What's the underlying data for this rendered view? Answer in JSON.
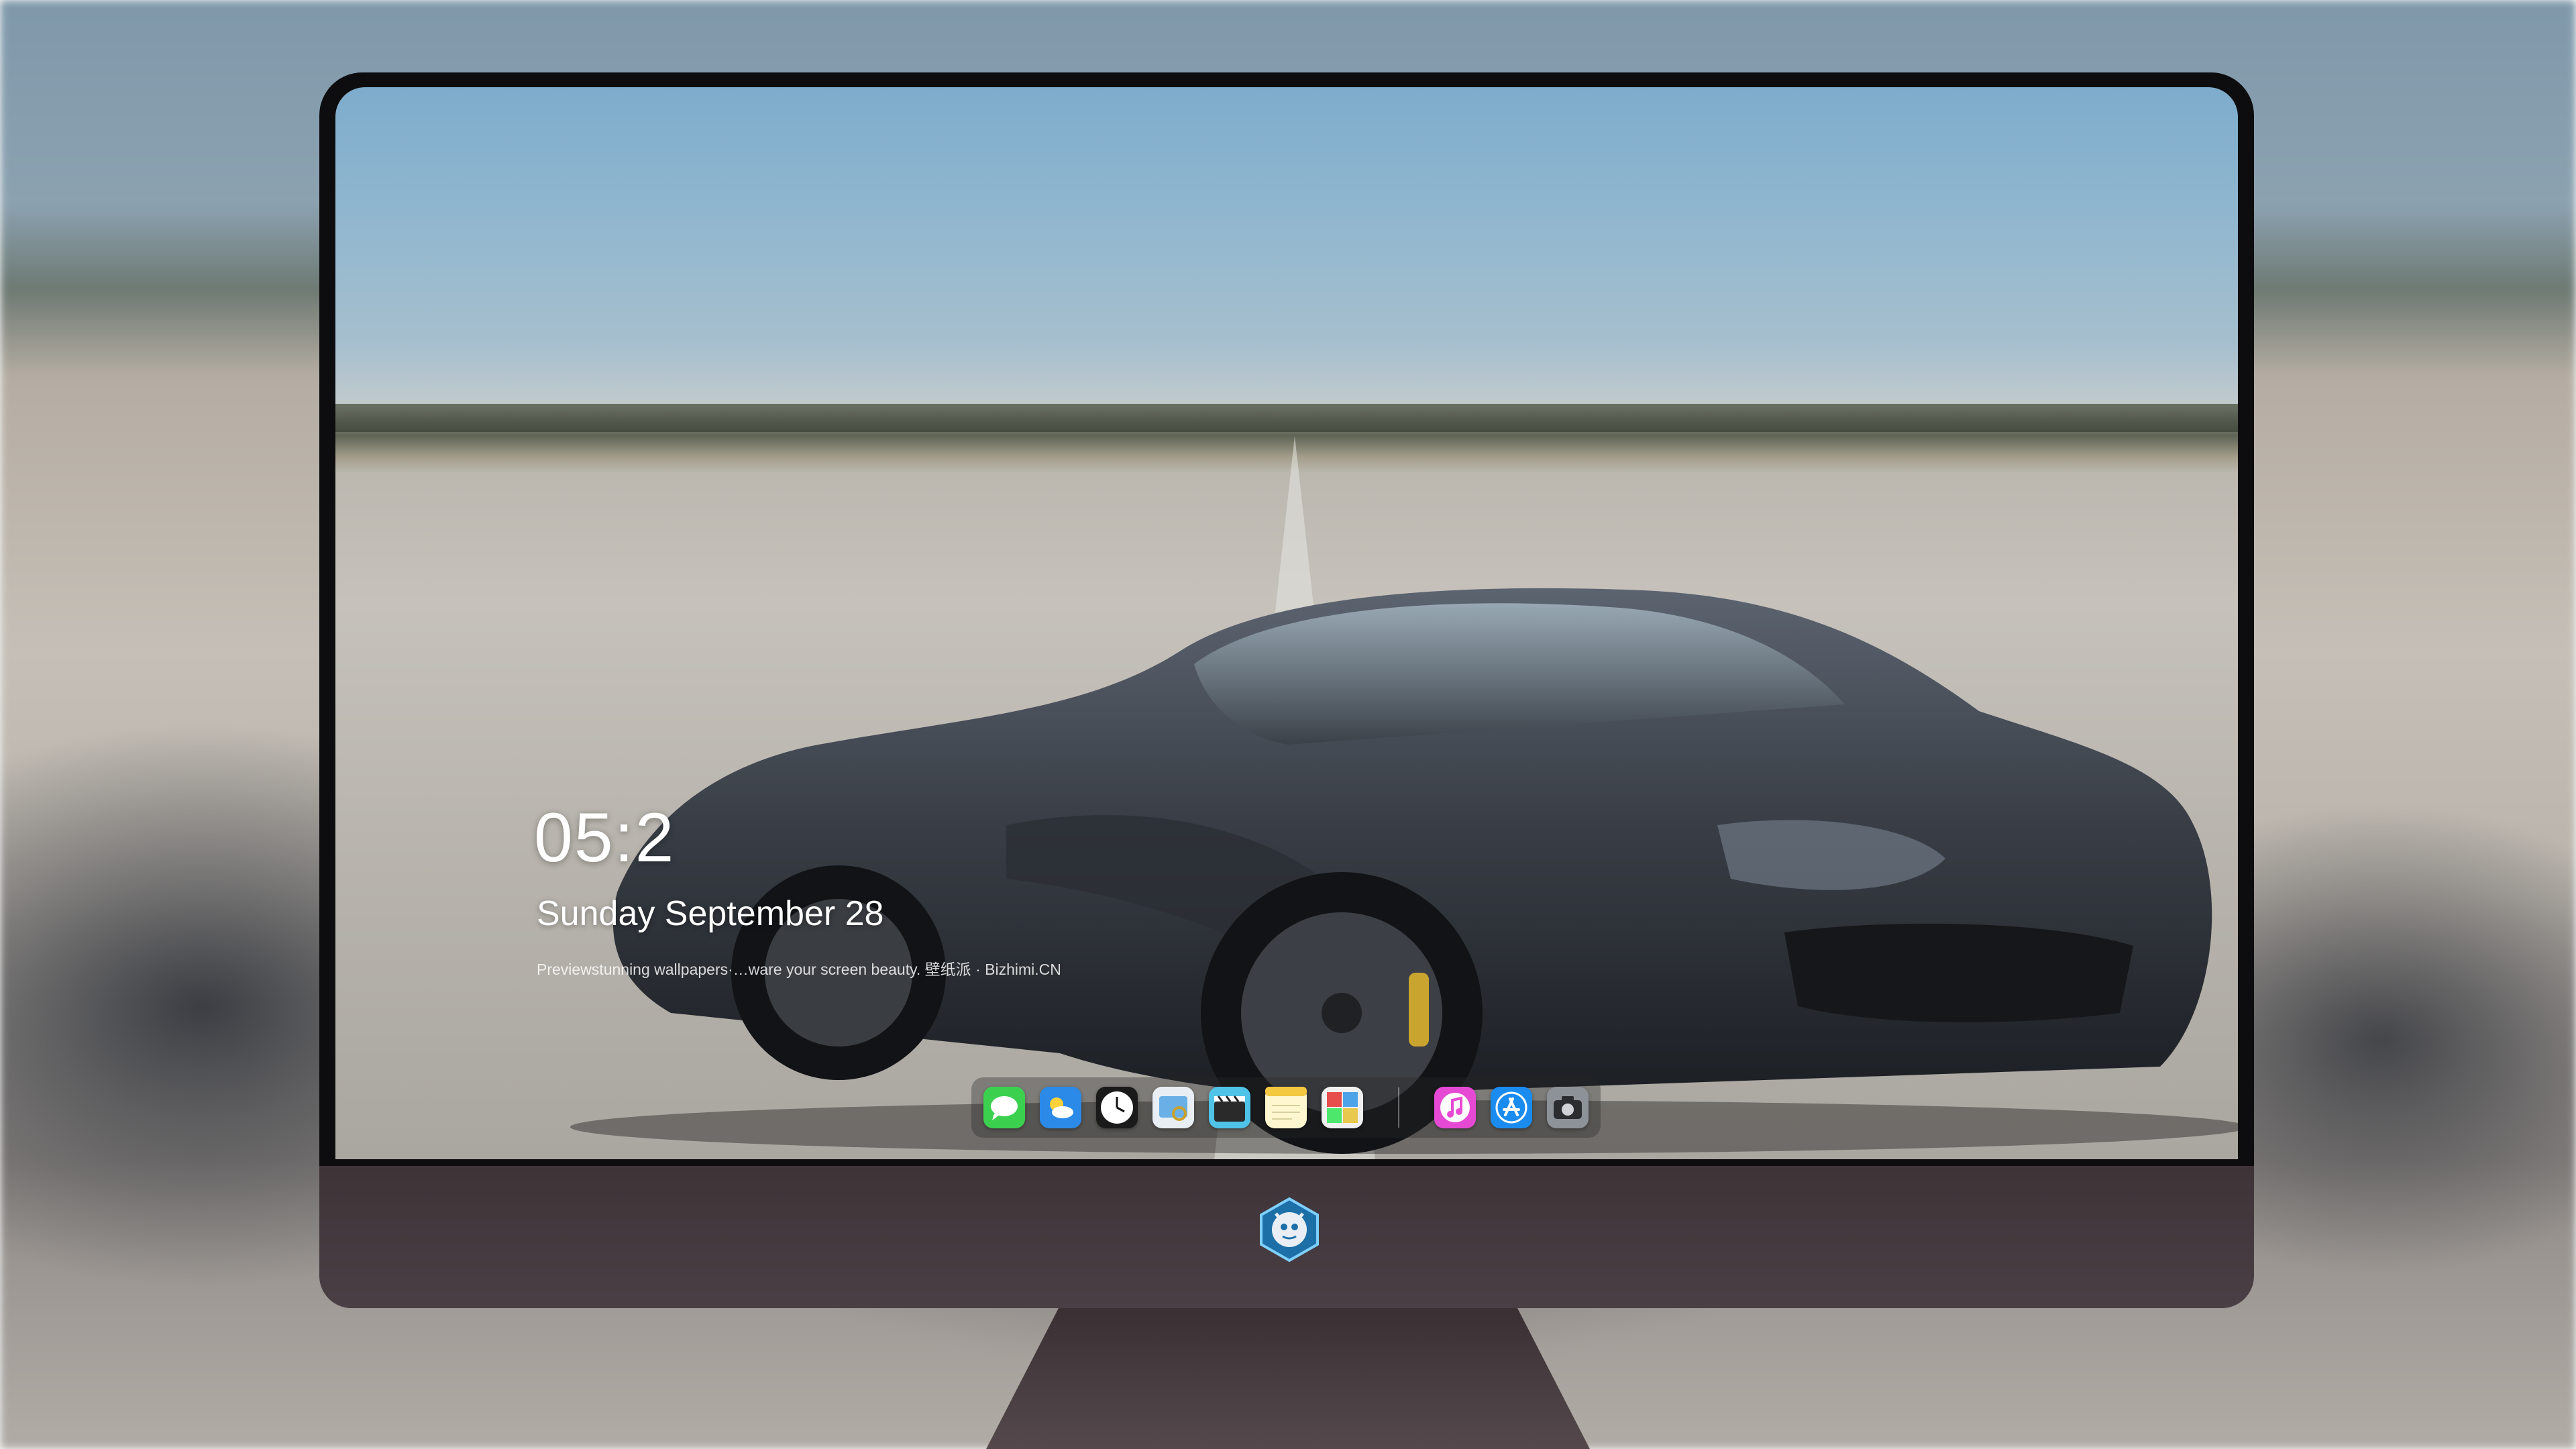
{
  "lock_screen": {
    "time": "05:2",
    "date": "Sunday September  28",
    "caption": "Previewstunning wallpapers·…ware your screen beauty. 壁纸派 · Bizhimi.CN"
  },
  "dock": {
    "apps": [
      "messages",
      "weather",
      "clock",
      "preview",
      "videos",
      "notes",
      "photo-booth",
      "music",
      "app-store",
      "camera"
    ]
  },
  "colors": {
    "chin": "#45393e",
    "bezel": "#0d0d0f",
    "sky": "#8db5cf"
  }
}
